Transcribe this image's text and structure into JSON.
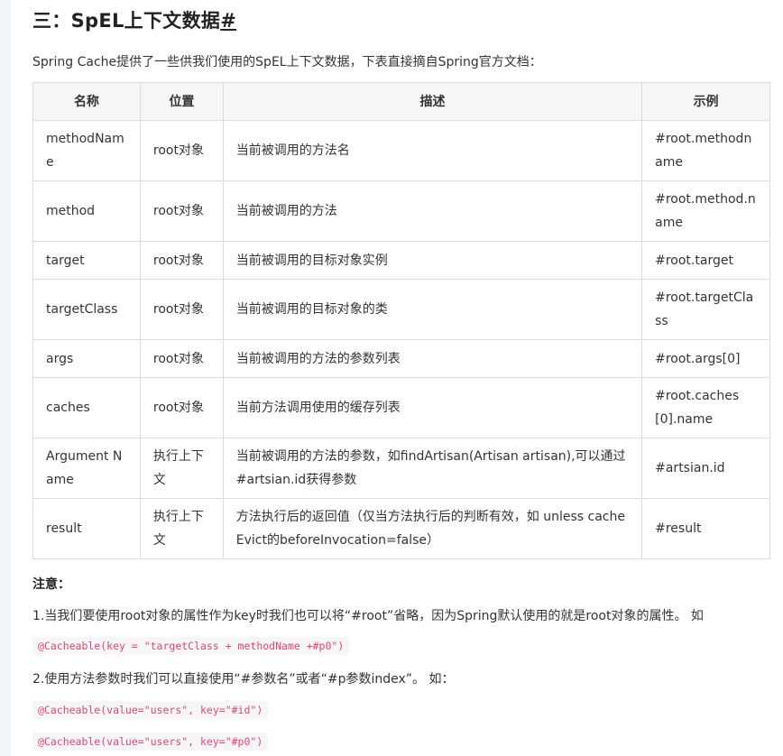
{
  "heading": {
    "text": "三：SpEL上下文数据",
    "anchor": "#"
  },
  "intro": "Spring Cache提供了一些供我们使用的SpEL上下文数据，下表直接摘自Spring官方文档：",
  "table": {
    "headers": [
      "名称",
      "位置",
      "描述",
      "示例"
    ],
    "rows": [
      {
        "name": "methodName",
        "location": "root对象",
        "desc": "当前被调用的方法名",
        "example": "#root.methodname"
      },
      {
        "name": "method",
        "location": "root对象",
        "desc": "当前被调用的方法",
        "example": "#root.method.name"
      },
      {
        "name": "target",
        "location": "root对象",
        "desc": "当前被调用的目标对象实例",
        "example": "#root.target"
      },
      {
        "name": "targetClass",
        "location": "root对象",
        "desc": "当前被调用的目标对象的类",
        "example": "#root.targetClass"
      },
      {
        "name": "args",
        "location": "root对象",
        "desc": "当前被调用的方法的参数列表",
        "example": "#root.args[0]"
      },
      {
        "name": "caches",
        "location": "root对象",
        "desc": "当前方法调用使用的缓存列表",
        "example": "#root.caches[0].name"
      },
      {
        "name": "Argument Name",
        "location": "执行上下文",
        "desc": "当前被调用的方法的参数，如findArtisan(Artisan artisan),可以通过#artsian.id获得参数",
        "example": "#artsian.id"
      },
      {
        "name": "result",
        "location": "执行上下文",
        "desc": "方法执行后的返回值（仅当方法执行后的判断有效，如 unless cacheEvict的beforeInvocation=false）",
        "example": "#result"
      }
    ]
  },
  "notes": {
    "title": "注意：",
    "p1": "1.当我们要使用root对象的属性作为key时我们也可以将“#root”省略，因为Spring默认使用的就是root对象的属性。 如",
    "code1": "@Cacheable(key = \"targetClass + methodName +#p0\")",
    "p2": "2.使用方法参数时我们可以直接使用“#参数名”或者“#p参数index”。 如：",
    "code2": "@Cacheable(value=\"users\", key=\"#id\")",
    "code3": "@Cacheable(value=\"users\", key=\"#p0\")"
  }
}
